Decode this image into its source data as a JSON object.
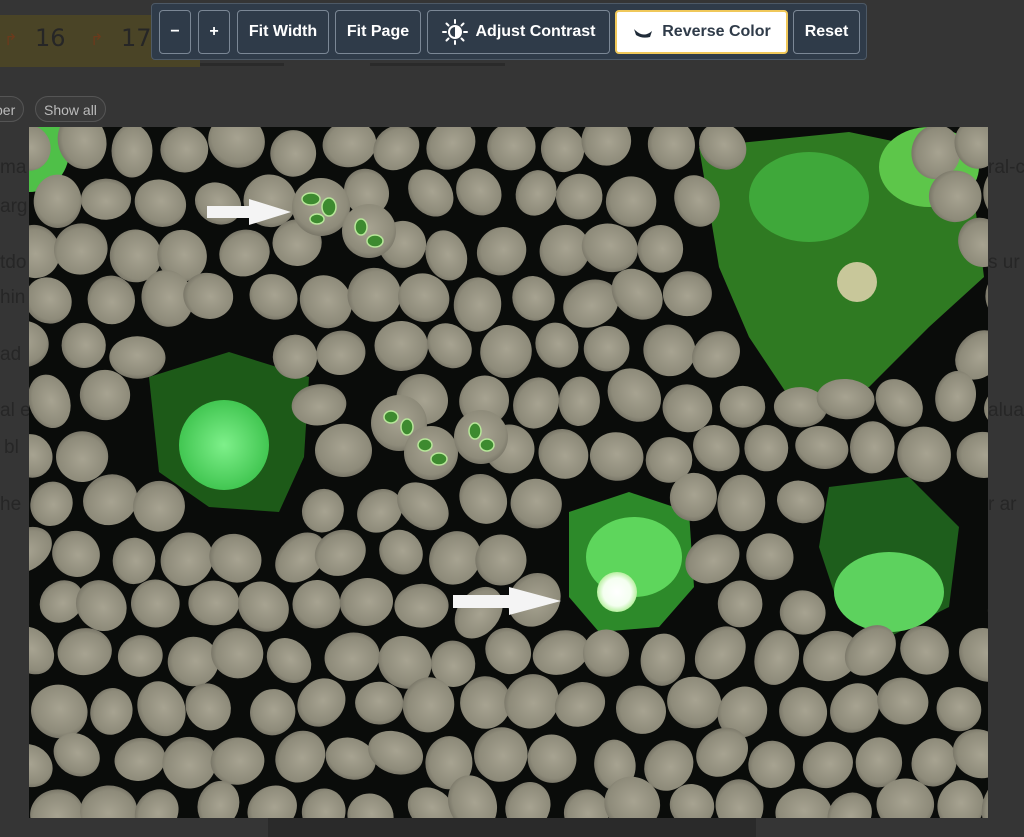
{
  "background": {
    "page_numbers": [
      "16",
      "17"
    ],
    "pills": [
      "per",
      "Show all"
    ],
    "left_fragments": [
      "ma",
      "arg",
      "tdo",
      "hin",
      "ad",
      "al e",
      "bl",
      "he"
    ],
    "right_fragments": [
      "ral-c",
      "s ur",
      "alua",
      "r ar"
    ]
  },
  "toolbar": {
    "zoom_out": "−",
    "zoom_in": "+",
    "fit_width": "Fit Width",
    "fit_page": "Fit Page",
    "adjust_contrast": "Adjust Contrast",
    "reverse_color": "Reverse Color",
    "reset": "Reset",
    "active_button": "Reverse Color"
  },
  "icons": {
    "contrast": "contrast-sun-icon",
    "reverse": "reverse-color-icon"
  }
}
